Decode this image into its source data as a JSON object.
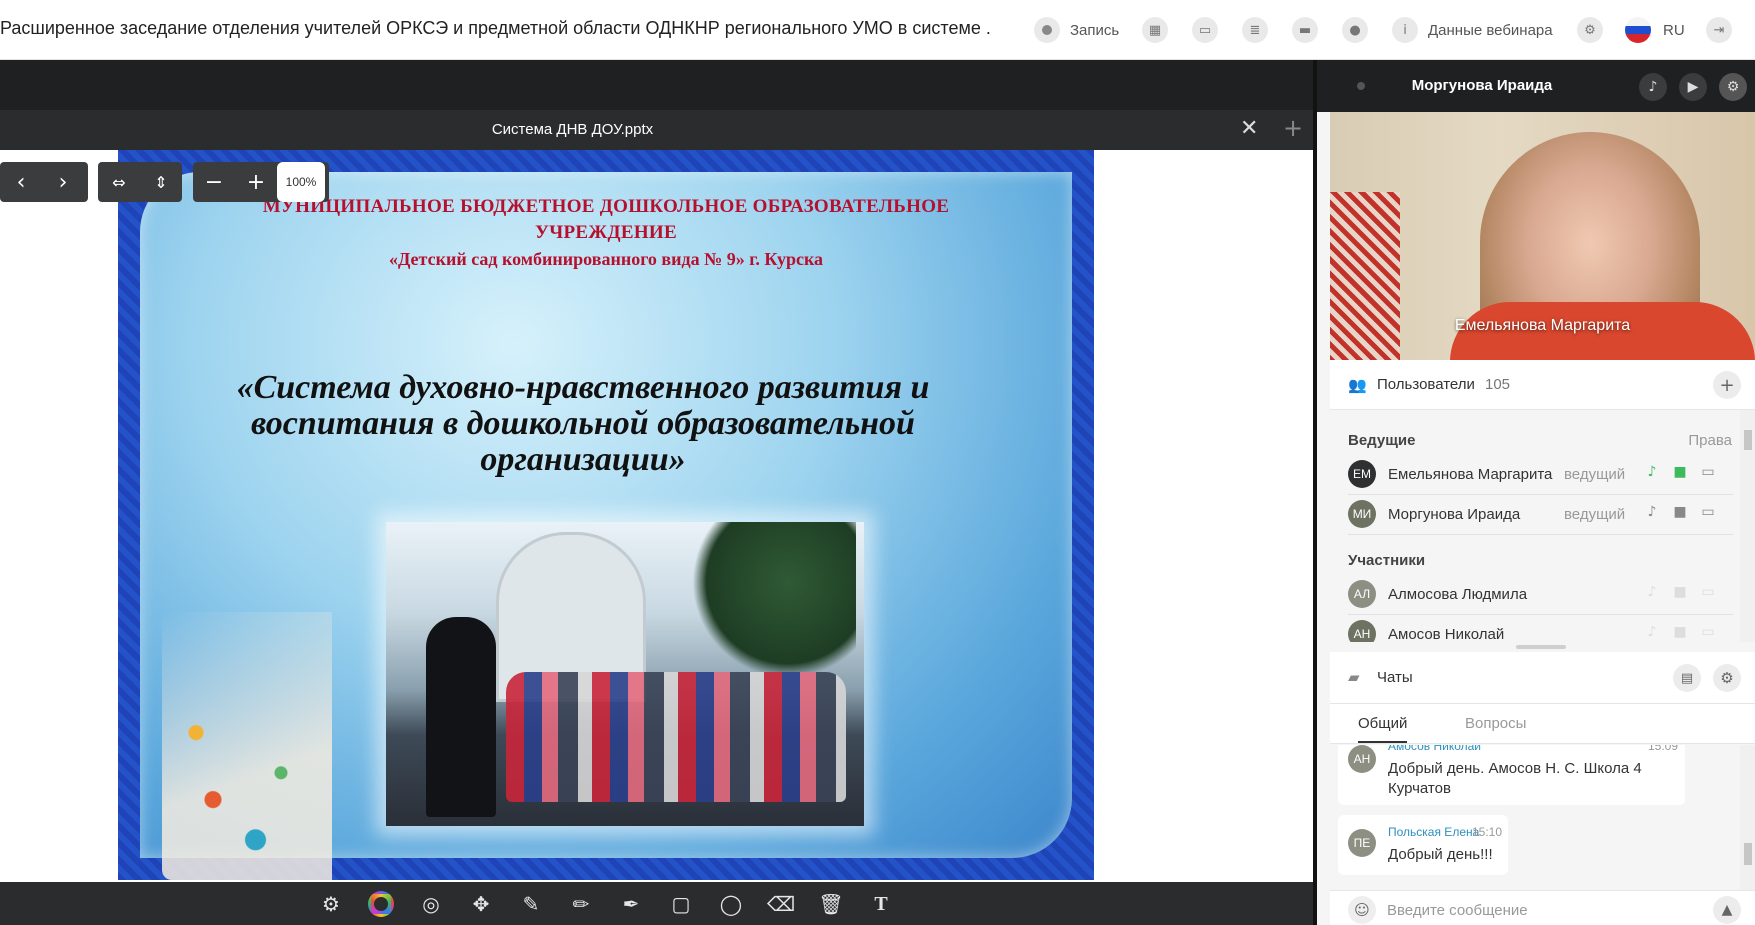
{
  "header": {
    "title": "Расширенное заседание отделения учителей ОРКСЭ и предметной области ОДНКНР регионального УМО в системе ...",
    "record_label": "Запись",
    "webinar_data_label": "Данные вебинара",
    "language": "RU"
  },
  "document": {
    "filename": "Система ДНВ ДОУ.pptx",
    "zoom": "100%"
  },
  "slide": {
    "header_line1": "МУНИЦИПАЛЬНОЕ БЮДЖЕТНОЕ ДОШКОЛЬНОЕ ОБРАЗОВАТЕЛЬНОЕ",
    "header_line2": "УЧРЕЖДЕНИЕ",
    "header_line3": "«Детский сад комбинированного вида № 9» г. Курска",
    "main_title": "«Система духовно-нравственного развития и воспитания в дошкольной образовательной организации»"
  },
  "video": {
    "header_name": "Моргунова Ираида",
    "speaker_name": "Емельянова Маргарита"
  },
  "users": {
    "label": "Пользователи",
    "count": "105",
    "hosts_label": "Ведущие",
    "rights_label": "Права",
    "participants_label": "Участники",
    "hosts": [
      {
        "initials": "ЕМ",
        "name": "Емельянова Маргарита",
        "role": "ведущий",
        "avatar_color": "#2f3032"
      },
      {
        "initials": "МИ",
        "name": "Моргунова Ираида",
        "role": "ведущий",
        "avatar_color": "#6e7262"
      }
    ],
    "participants": [
      {
        "initials": "АЛ",
        "name": "Алмосова Людмила",
        "avatar_color": "#8d8f83"
      },
      {
        "initials": "АН",
        "name": "Амосов Николай",
        "avatar_color": "#6e7262"
      }
    ]
  },
  "chats": {
    "label": "Чаты",
    "tabs": [
      "Общий",
      "Вопросы"
    ],
    "messages": [
      {
        "initials": "АН",
        "author": "Амосов Николай",
        "time": "15:09",
        "text_line1": "Добрый день. Амосов Н. С. Школа 4",
        "text_line2": "Курчатов"
      },
      {
        "initials": "ПЕ",
        "author": "Польская Елена",
        "time": "15:10",
        "text_line1": "Добрый день!!!"
      }
    ],
    "input_placeholder": "Введите сообщение"
  },
  "colors": {
    "topbar_bg": "#ffffff",
    "stage_bg": "#1e2022",
    "toolbar_bg": "#2a2c2e",
    "mic_active": "#3dbb5c",
    "chat_author": "#2e8fbd"
  }
}
